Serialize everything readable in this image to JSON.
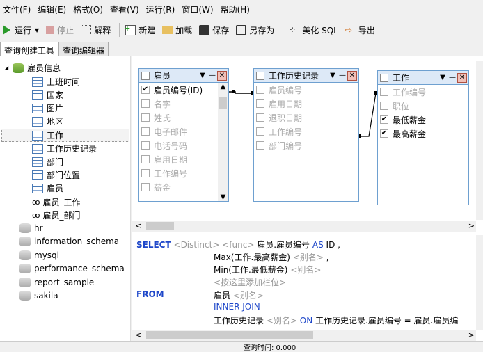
{
  "menu": [
    "文件(F)",
    "编辑(E)",
    "格式(O)",
    "查看(V)",
    "运行(R)",
    "窗口(W)",
    "帮助(H)"
  ],
  "toolbar": {
    "run": "运行",
    "stop": "停止",
    "explain": "解释",
    "new": "新建",
    "load": "加载",
    "save": "保存",
    "saveas": "另存为",
    "beautify": "美化 SQL",
    "export": "导出"
  },
  "tabs": [
    "查询创建工具",
    "查询编辑器"
  ],
  "tree": {
    "root": "雇员信息",
    "tables": [
      "上班时间",
      "国家",
      "图片",
      "地区",
      "工作",
      "工作历史记录",
      "部门",
      "部门位置",
      "雇员"
    ],
    "views": [
      "雇员_工作",
      "雇员_部门"
    ],
    "dbs": [
      "hr",
      "information_schema",
      "mysql",
      "performance_schema",
      "report_sample",
      "sakila"
    ]
  },
  "boxes": [
    {
      "title": "雇员",
      "fields": [
        {
          "n": "雇员编号(ID)",
          "c": true
        },
        {
          "n": "名字",
          "c": false
        },
        {
          "n": "姓氏",
          "c": false
        },
        {
          "n": "电子邮件",
          "c": false
        },
        {
          "n": "电话号码",
          "c": false
        },
        {
          "n": "雇用日期",
          "c": false
        },
        {
          "n": "工作编号",
          "c": false
        },
        {
          "n": "薪金",
          "c": false
        }
      ]
    },
    {
      "title": "工作历史记录",
      "fields": [
        {
          "n": "雇员编号",
          "c": false
        },
        {
          "n": "雇用日期",
          "c": false
        },
        {
          "n": "退职日期",
          "c": false
        },
        {
          "n": "工作编号",
          "c": false
        },
        {
          "n": "部门编号",
          "c": false
        }
      ]
    },
    {
      "title": "工作",
      "fields": [
        {
          "n": "工作编号",
          "c": false
        },
        {
          "n": "职位",
          "c": false
        },
        {
          "n": "最低薪金",
          "c": true
        },
        {
          "n": "最高薪金",
          "c": true
        }
      ]
    }
  ],
  "sql": {
    "select": "SELECT",
    "distinct": "<Distinct>",
    "func": "<func>",
    "l1": "雇员.雇员编号",
    "as": "AS",
    "l1b": "ID ,",
    "l2": "Max(工作.最高薪金)",
    "alias": "<别名>",
    "comma": ",",
    "l3": "Min(工作.最低薪金)",
    "l4": "<按这里添加栏位>",
    "from": "FROM",
    "t1": "雇员",
    "inner": "INNER JOIN",
    "t2": "工作历史记录",
    "on": "ON",
    "cond": "工作历史记录.雇员编号 = 雇员.雇员编"
  },
  "status": "查询时间: 0.000"
}
